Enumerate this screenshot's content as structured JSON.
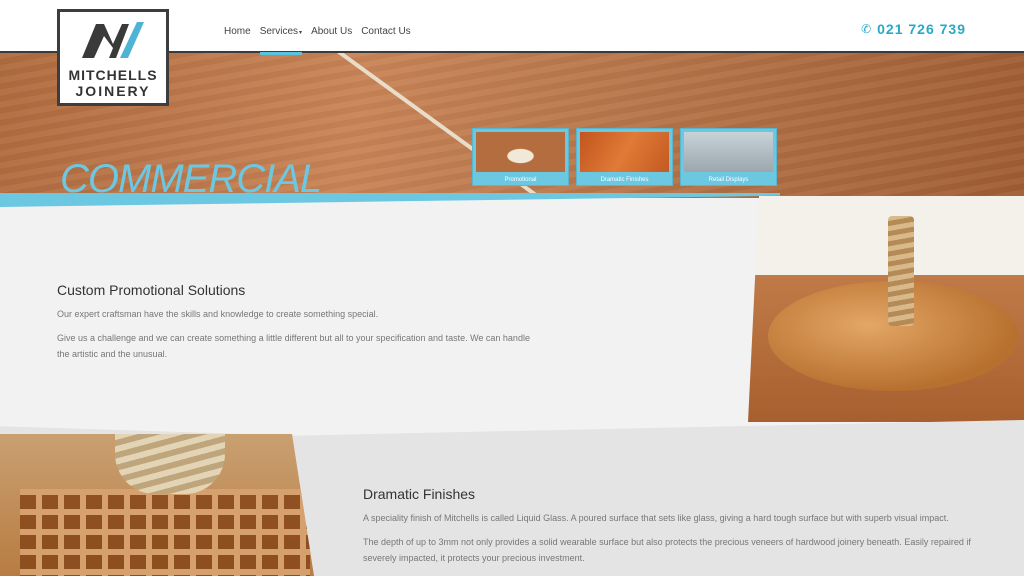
{
  "header": {
    "logo_line1": "MITCHELLS",
    "logo_line2": "JOINERY",
    "phone": "021 726 739",
    "nav": [
      "Home",
      "Services",
      "About Us",
      "Contact Us"
    ]
  },
  "hero": {
    "title": "COMMERCIAL",
    "thumbs": [
      "Promotional",
      "Dramatic Finishes",
      "Retail Displays"
    ]
  },
  "section1": {
    "heading": "Custom Promotional Solutions",
    "p1": "Our expert craftsman have the skills and knowledge to create something special.",
    "p2": "Give us a challenge and we can create something a little different but all to your specification and taste. We can handle the artistic and the unusual."
  },
  "section2": {
    "heading": "Dramatic Finishes",
    "p1": "A speciality finish of Mitchells is called Liquid Glass. A poured surface that sets like glass, giving a hard tough surface but with superb visual impact.",
    "p2": "The depth of up to 3mm not only provides a solid wearable surface but also protects the precious veneers of hardwood joinery beneath. Easily repaired if severely impacted, it protects your precious investment."
  },
  "colors": {
    "accent": "#6cc7e1",
    "phone": "#29a8c9"
  }
}
